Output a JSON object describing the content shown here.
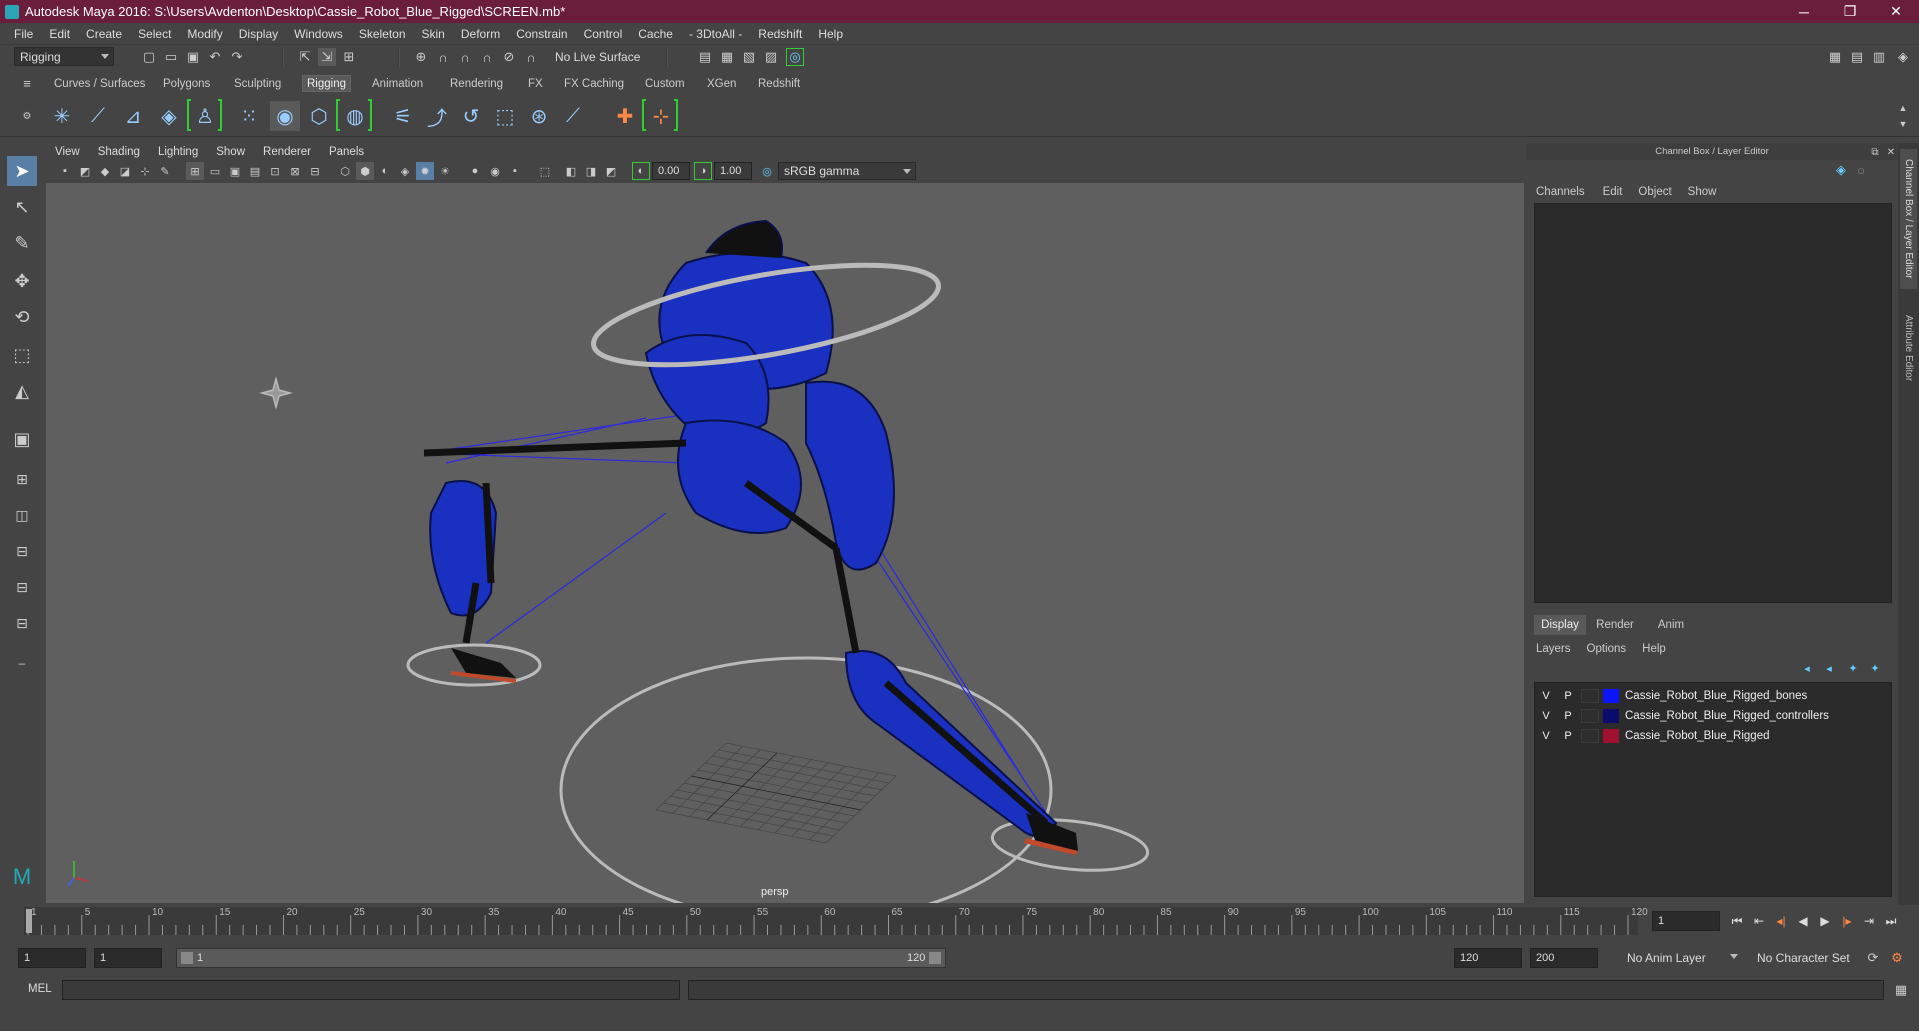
{
  "window": {
    "title": "Autodesk Maya 2016: S:\\Users\\Avdenton\\Desktop\\Cassie_Robot_Blue_Rigged\\SCREEN.mb*",
    "minimize": "─",
    "maximize": "❐",
    "close": "✕"
  },
  "menubar": [
    "File",
    "Edit",
    "Create",
    "Select",
    "Modify",
    "Display",
    "Windows",
    "Skeleton",
    "Skin",
    "Deform",
    "Constrain",
    "Control",
    "Cache",
    "- 3DtoAll -",
    "Redshift",
    "Help"
  ],
  "statusline": {
    "mode": "Rigging",
    "live_surface": "No Live Surface"
  },
  "shelf_tabs": [
    "Curves / Surfaces",
    "Polygons",
    "Sculpting",
    "Rigging",
    "Animation",
    "Rendering",
    "FX",
    "FX Caching",
    "Custom",
    "XGen",
    "Redshift"
  ],
  "active_shelf_tab": "Rigging",
  "viewport": {
    "menu": [
      "View",
      "Shading",
      "Lighting",
      "Show",
      "Renderer",
      "Panels"
    ],
    "exposure": "0.00",
    "gamma": "1.00",
    "color_space": "sRGB gamma",
    "camera_label": "persp",
    "bg_color": "#5f5f5f",
    "body_color": "#1a30c0"
  },
  "channel_box": {
    "title": "Channel Box / Layer Editor",
    "menu": [
      "Channels",
      "Edit",
      "Object",
      "Show"
    ]
  },
  "layer_editor": {
    "tabs": [
      "Display",
      "Render",
      "Anim"
    ],
    "active_tab": "Display",
    "menu": [
      "Layers",
      "Options",
      "Help"
    ],
    "layers": [
      {
        "v": "V",
        "p": "P",
        "color": "#0a14ff",
        "name": "Cassie_Robot_Blue_Rigged_bones"
      },
      {
        "v": "V",
        "p": "P",
        "color": "#0b0b6e",
        "name": "Cassie_Robot_Blue_Rigged_controllers"
      },
      {
        "v": "V",
        "p": "P",
        "color": "#a01030",
        "name": "Cassie_Robot_Blue_Rigged"
      }
    ]
  },
  "side_tabs": [
    "Channel Box / Layer Editor",
    "Attribute Editor"
  ],
  "timeline": {
    "ticks": [
      "1",
      "5",
      "10",
      "15",
      "20",
      "25",
      "30",
      "35",
      "40",
      "45",
      "50",
      "55",
      "60",
      "65",
      "70",
      "75",
      "80",
      "85",
      "90",
      "95",
      "100",
      "105",
      "110",
      "115",
      "120"
    ],
    "current_frame": "1"
  },
  "range": {
    "start": "1",
    "playback_start": "1",
    "slider_start": "1",
    "slider_end": "120",
    "playback_end": "120",
    "end": "200",
    "anim_layer": "No Anim Layer",
    "char_set": "No Character Set"
  },
  "command_line": {
    "label": "MEL"
  }
}
